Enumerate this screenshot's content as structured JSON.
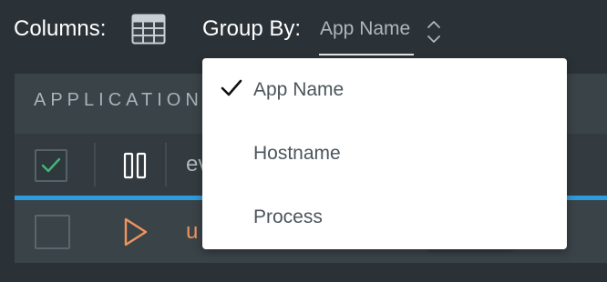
{
  "toolbar": {
    "columns_label": "Columns:",
    "columns_icon": "table-columns-icon",
    "group_by_label": "Group By:",
    "group_by_value": "App Name",
    "group_by_icon": "chevron-up-down-icon"
  },
  "panel": {
    "title": "APPLICATION",
    "header_checkbox_checked": true,
    "pause_icon": "pause-icon",
    "header_column_partial": "ev",
    "row": {
      "checkbox_checked": false,
      "play_icon": "play-icon",
      "text_partial": "u"
    }
  },
  "group_by_menu": {
    "items": [
      {
        "label": "App Name",
        "selected": true
      },
      {
        "label": "Hostname",
        "selected": false
      },
      {
        "label": "Process",
        "selected": false
      }
    ]
  },
  "colors": {
    "background": "#2b3237",
    "panel": "#3a4348",
    "accent_blue": "#2e9cdc",
    "accent_orange": "#f0945d",
    "check_green": "#3fb97a",
    "menu_text": "#4b555b"
  }
}
